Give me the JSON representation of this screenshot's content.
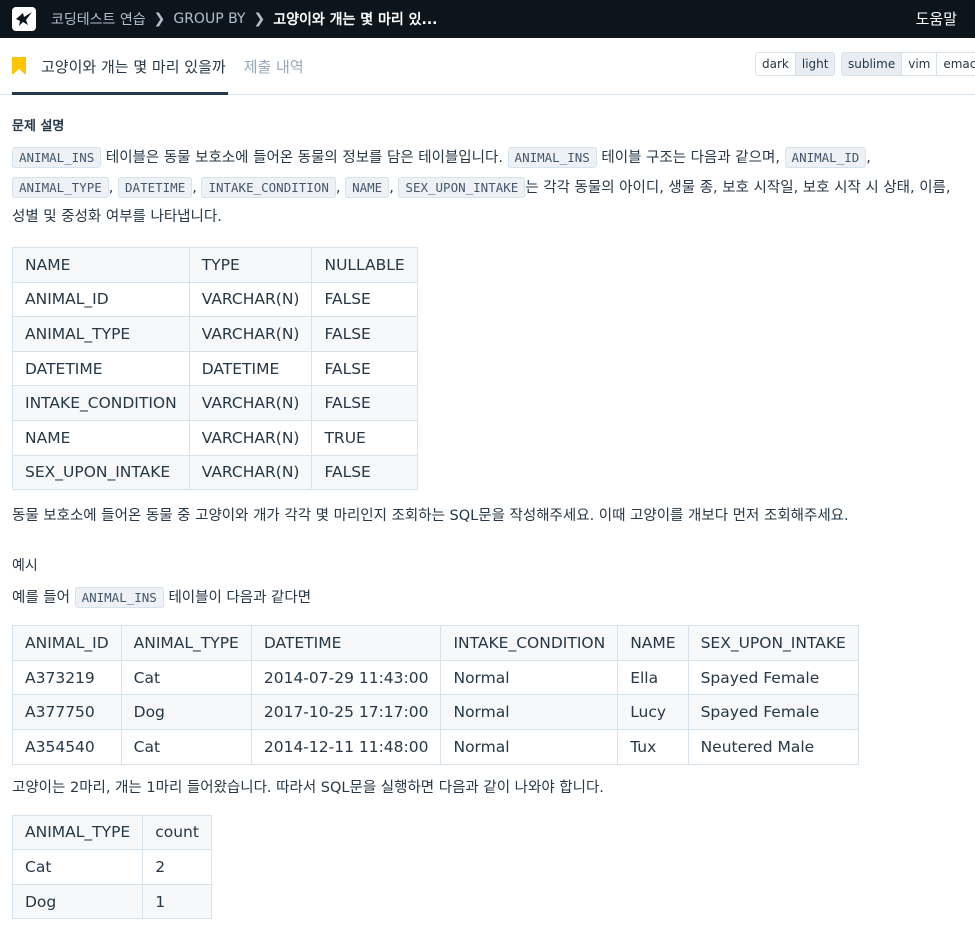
{
  "header": {
    "breadcrumbs": [
      "코딩테스트 연습",
      "GROUP BY",
      "고양이와 개는 몇 마리 있..."
    ],
    "help": "도움말"
  },
  "tabs": {
    "active": "고양이와 개는 몇 마리 있을까",
    "submissions": "제출 내역"
  },
  "theme_buttons": [
    "dark",
    "light"
  ],
  "keymap_buttons": [
    "sublime",
    "vim",
    "emacs"
  ],
  "problem": {
    "heading": "문제 설명",
    "intro": {
      "c1": "ANIMAL_INS",
      "t1": " 테이블은 동물 보호소에 들어온 동물의 정보를 담은 테이블입니다. ",
      "c2": "ANIMAL_INS",
      "t2": " 테이블 구조는 다음과 같으며, ",
      "c3": "ANIMAL_ID",
      "t3": ", ",
      "c4": "ANIMAL_TYPE",
      "t4": ", ",
      "c5": "DATETIME",
      "t5": ", ",
      "c6": "INTAKE_CONDITION",
      "t6": ", ",
      "c7": "NAME",
      "t7": ", ",
      "c8": "SEX_UPON_INTAKE",
      "t8": "는 각각 동물의 아이디, 생물 종, 보호 시작일, 보호 시작 시 상태, 이름, 성별 및 중성화 여부를 나타냅니다."
    },
    "schema_table": {
      "headers": [
        "NAME",
        "TYPE",
        "NULLABLE"
      ],
      "rows": [
        [
          "ANIMAL_ID",
          "VARCHAR(N)",
          "FALSE"
        ],
        [
          "ANIMAL_TYPE",
          "VARCHAR(N)",
          "FALSE"
        ],
        [
          "DATETIME",
          "DATETIME",
          "FALSE"
        ],
        [
          "INTAKE_CONDITION",
          "VARCHAR(N)",
          "FALSE"
        ],
        [
          "NAME",
          "VARCHAR(N)",
          "TRUE"
        ],
        [
          "SEX_UPON_INTAKE",
          "VARCHAR(N)",
          "FALSE"
        ]
      ]
    },
    "task": "동물 보호소에 들어온 동물 중 고양이와 개가 각각 몇 마리인지 조회하는 SQL문을 작성해주세요. 이때 고양이를 개보다 먼저 조회해주세요.",
    "example_heading": "예시",
    "example_intro": {
      "t1": "예를 들어 ",
      "c1": "ANIMAL_INS",
      "t2": " 테이블이 다음과 같다면"
    },
    "example_table": {
      "headers": [
        "ANIMAL_ID",
        "ANIMAL_TYPE",
        "DATETIME",
        "INTAKE_CONDITION",
        "NAME",
        "SEX_UPON_INTAKE"
      ],
      "rows": [
        [
          "A373219",
          "Cat",
          "2014-07-29 11:43:00",
          "Normal",
          "Ella",
          "Spayed Female"
        ],
        [
          "A377750",
          "Dog",
          "2017-10-25 17:17:00",
          "Normal",
          "Lucy",
          "Spayed Female"
        ],
        [
          "A354540",
          "Cat",
          "2014-12-11 11:48:00",
          "Normal",
          "Tux",
          "Neutered Male"
        ]
      ]
    },
    "result_intro": "고양이는 2마리, 개는 1마리 들어왔습니다. 따라서 SQL문을 실행하면 다음과 같이 나와야 합니다.",
    "result_table": {
      "headers": [
        "ANIMAL_TYPE",
        "count"
      ],
      "rows": [
        [
          "Cat",
          "2"
        ],
        [
          "Dog",
          "1"
        ]
      ]
    }
  }
}
